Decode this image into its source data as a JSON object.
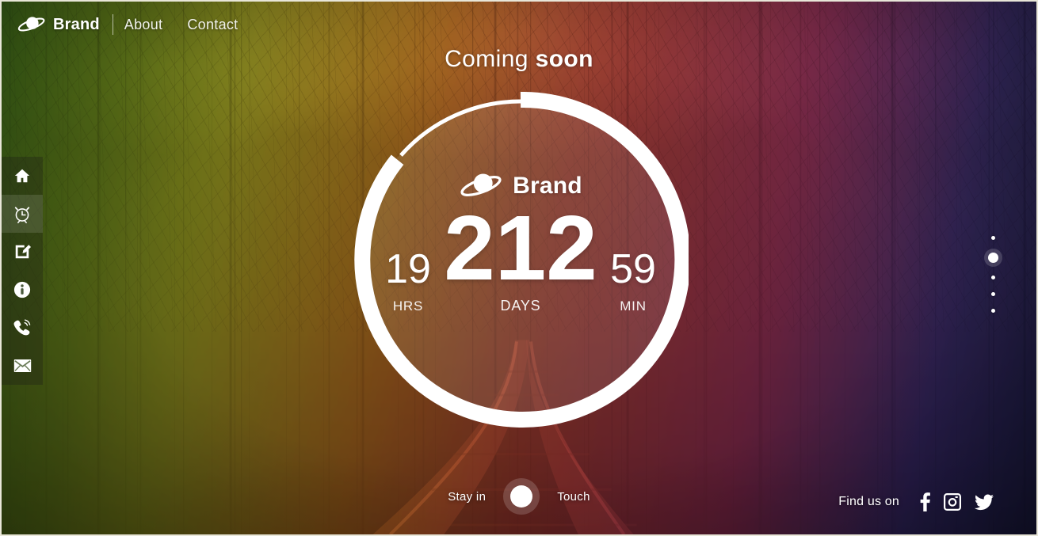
{
  "header": {
    "logo_icon": "saturn-planet-icon",
    "brand": "Brand",
    "nav": [
      {
        "label": "About"
      },
      {
        "label": "Contact"
      }
    ]
  },
  "sidebar": {
    "items": [
      {
        "icon": "home-icon",
        "name": "home",
        "active": false
      },
      {
        "icon": "alarm-clock-icon",
        "name": "clock",
        "active": true
      },
      {
        "icon": "edit-square-icon",
        "name": "edit",
        "active": false
      },
      {
        "icon": "info-circle-icon",
        "name": "info",
        "active": false
      },
      {
        "icon": "phone-ring-icon",
        "name": "phone",
        "active": false
      },
      {
        "icon": "envelope-icon",
        "name": "mail",
        "active": false
      }
    ]
  },
  "hero": {
    "title_light": "Coming",
    "title_bold": "soon",
    "inner_logo_icon": "saturn-planet-icon",
    "inner_brand": "Brand",
    "ring_progress_percent": 83
  },
  "countdown": {
    "hours": {
      "value": "19",
      "label": "HRS"
    },
    "days": {
      "value": "212",
      "label": "DAYS"
    },
    "minutes": {
      "value": "59",
      "label": "MIN"
    }
  },
  "stay_in_touch": {
    "text_left": "Stay in",
    "text_right": "Touch",
    "button_icon": "circle-button-icon"
  },
  "social": {
    "label": "Find us on",
    "links": [
      {
        "icon": "facebook-icon",
        "name": "Facebook"
      },
      {
        "icon": "instagram-icon",
        "name": "Instagram"
      },
      {
        "icon": "twitter-icon",
        "name": "Twitter"
      }
    ]
  },
  "pager": {
    "dots": 5,
    "active_index": 1
  },
  "colors": {
    "text": "#ffffff",
    "ring": "#ffffff",
    "gradient_green": "#3f7a16",
    "gradient_yellow": "#c9c125",
    "gradient_orange": "#e2701d",
    "gradient_red": "#cf3a35",
    "gradient_magenta": "#b02a62",
    "gradient_purple": "#3b2a7a",
    "gradient_navy": "#1b1b55"
  }
}
